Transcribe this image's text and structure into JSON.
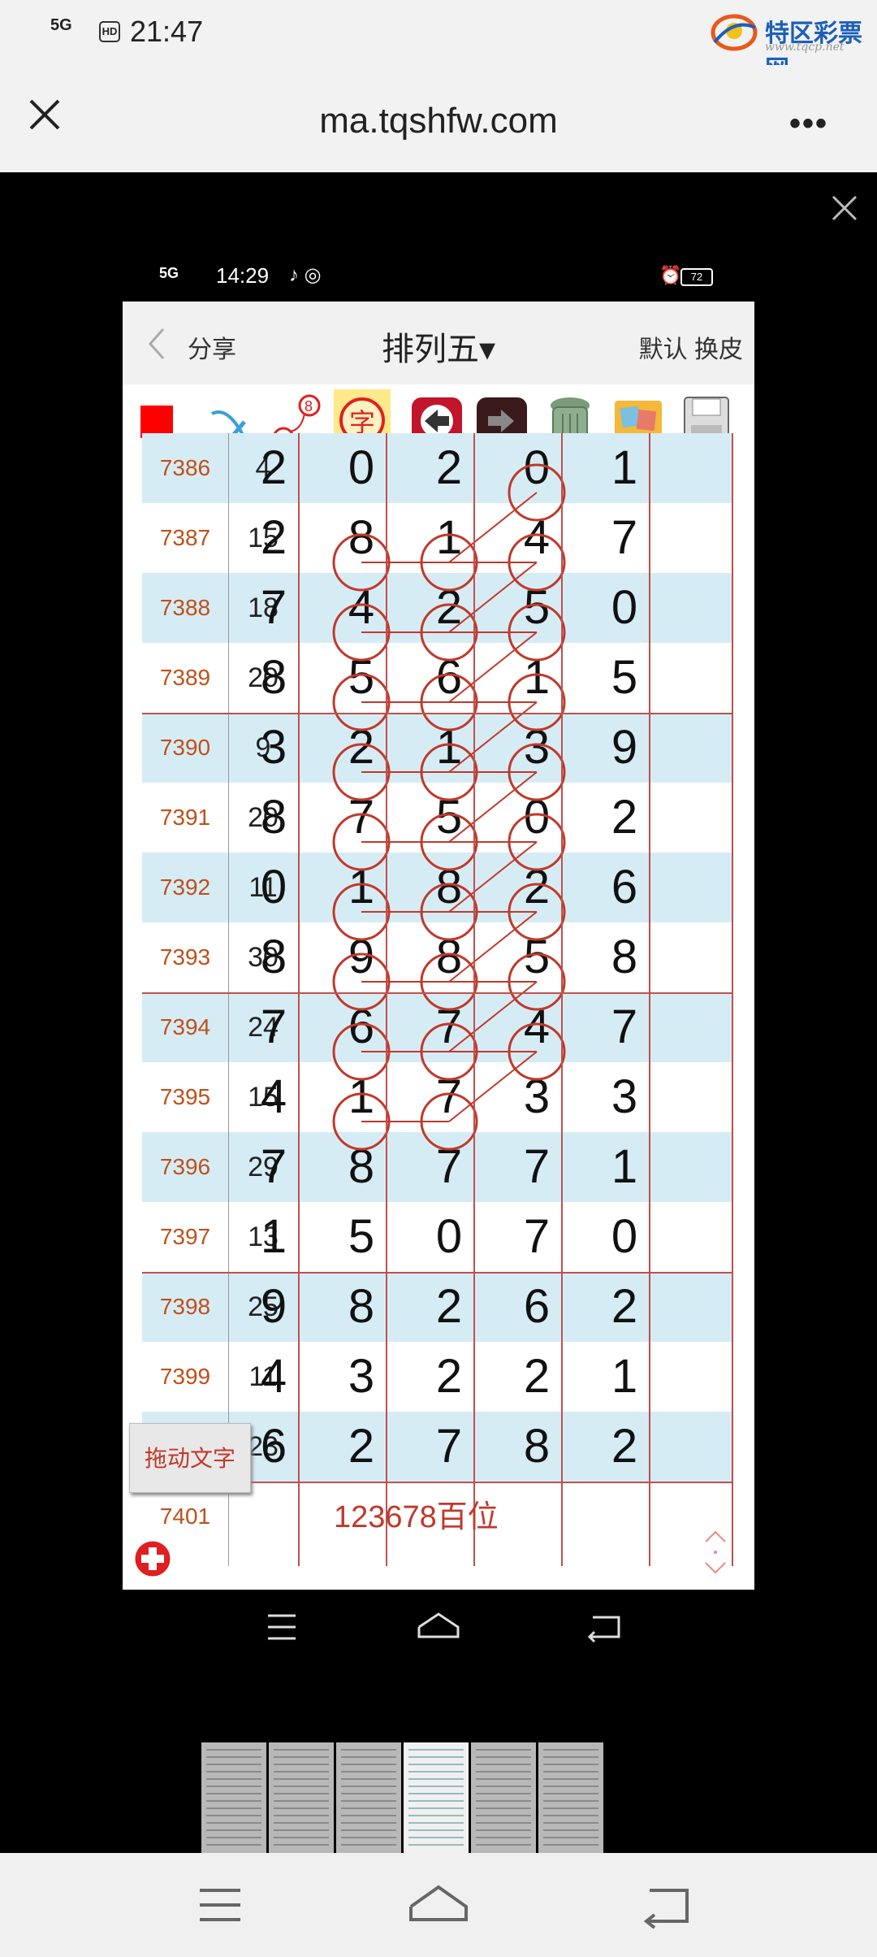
{
  "outer_status": {
    "signal": "5G",
    "hd": "HD",
    "time": "21:47"
  },
  "watermark": {
    "text": "特区彩票网",
    "sub": "www.tqcp.net"
  },
  "browser": {
    "url": "ma.tqshfw.com",
    "more_label": "•••"
  },
  "inner_status": {
    "signal": "5G",
    "time": "14:29",
    "battery": "72"
  },
  "app": {
    "back_label": "分享",
    "title": "排列五▾",
    "right_label": "默认 换皮",
    "toolbar": [
      "red-square-icon",
      "pen-check-icon",
      "connect-numbers-icon",
      "character-icon",
      "undo-arrow-icon",
      "redo-arrow-icon",
      "trash-icon",
      "photos-icon",
      "save-disk-icon"
    ],
    "rows": [
      {
        "period": "7386",
        "sum": "4",
        "digits": [
          "2",
          "0",
          "2",
          "0",
          "1"
        ]
      },
      {
        "period": "7387",
        "sum": "15",
        "digits": [
          "2",
          "8",
          "1",
          "4",
          "7"
        ]
      },
      {
        "period": "7388",
        "sum": "18",
        "digits": [
          "7",
          "4",
          "2",
          "5",
          "0"
        ]
      },
      {
        "period": "7389",
        "sum": "20",
        "digits": [
          "8",
          "5",
          "6",
          "1",
          "5"
        ]
      },
      {
        "period": "7390",
        "sum": "9",
        "digits": [
          "3",
          "2",
          "1",
          "3",
          "9"
        ]
      },
      {
        "period": "7391",
        "sum": "20",
        "digits": [
          "8",
          "7",
          "5",
          "0",
          "2"
        ]
      },
      {
        "period": "7392",
        "sum": "11",
        "digits": [
          "0",
          "1",
          "8",
          "2",
          "6"
        ]
      },
      {
        "period": "7393",
        "sum": "30",
        "digits": [
          "8",
          "9",
          "8",
          "5",
          "8"
        ]
      },
      {
        "period": "7394",
        "sum": "24",
        "digits": [
          "7",
          "6",
          "7",
          "4",
          "7"
        ]
      },
      {
        "period": "7395",
        "sum": "15",
        "digits": [
          "4",
          "1",
          "7",
          "3",
          "3"
        ]
      },
      {
        "period": "7396",
        "sum": "29",
        "digits": [
          "7",
          "8",
          "7",
          "7",
          "1"
        ]
      },
      {
        "period": "7397",
        "sum": "13",
        "digits": [
          "1",
          "5",
          "0",
          "7",
          "0"
        ]
      },
      {
        "period": "7398",
        "sum": "25",
        "digits": [
          "9",
          "8",
          "2",
          "6",
          "2"
        ]
      },
      {
        "period": "7399",
        "sum": "11",
        "digits": [
          "4",
          "3",
          "2",
          "2",
          "1"
        ]
      },
      {
        "period": "7400",
        "sum": "23",
        "digits": [
          "6",
          "2",
          "7",
          "8",
          "2"
        ]
      },
      {
        "period": "7401",
        "sum": "",
        "digits": [
          "",
          "",
          "",
          "",
          ""
        ]
      }
    ],
    "circles": [
      [
        0,
        3
      ],
      [
        1,
        1
      ],
      [
        1,
        2
      ],
      [
        1,
        3
      ],
      [
        2,
        1
      ],
      [
        2,
        2
      ],
      [
        2,
        3
      ],
      [
        3,
        1
      ],
      [
        3,
        2
      ],
      [
        3,
        3
      ],
      [
        4,
        1
      ],
      [
        4,
        2
      ],
      [
        4,
        3
      ],
      [
        5,
        1
      ],
      [
        5,
        2
      ],
      [
        5,
        3
      ],
      [
        6,
        1
      ],
      [
        6,
        2
      ],
      [
        6,
        3
      ],
      [
        7,
        1
      ],
      [
        7,
        2
      ],
      [
        7,
        3
      ],
      [
        8,
        1
      ],
      [
        8,
        2
      ],
      [
        8,
        3
      ],
      [
        9,
        1
      ],
      [
        9,
        2
      ]
    ],
    "drag_button": "拖动文字",
    "note": "123678百位",
    "accent_color": "#c0392b"
  },
  "thumbnail_count": 6
}
